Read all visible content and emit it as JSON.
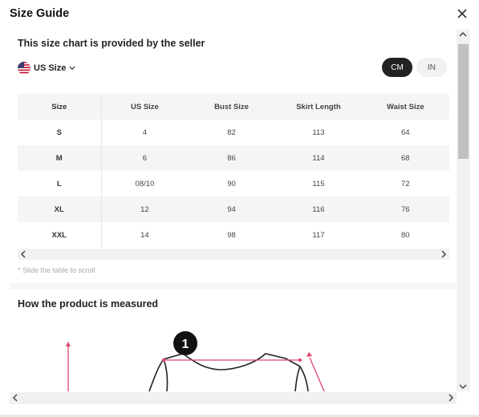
{
  "header": {
    "title": "Size Guide",
    "close_icon": "close-icon"
  },
  "chart": {
    "subtitle": "This size chart is provided by the seller",
    "size_region": "US Size",
    "units": {
      "cm": "CM",
      "in": "IN",
      "selected": "CM"
    },
    "columns": [
      "Size",
      "US Size",
      "Bust Size",
      "Skirt Length",
      "Waist Size"
    ],
    "rows": [
      [
        "S",
        "4",
        "82",
        "113",
        "64"
      ],
      [
        "M",
        "6",
        "86",
        "114",
        "68"
      ],
      [
        "L",
        "08/10",
        "90",
        "115",
        "72"
      ],
      [
        "XL",
        "12",
        "94",
        "116",
        "76"
      ],
      [
        "XXL",
        "14",
        "98",
        "117",
        "80"
      ]
    ],
    "scroll_hint": "* Slide the table to scroll"
  },
  "measure": {
    "title": "How the product is measured",
    "marker": "1"
  },
  "colors": {
    "accent_line": "#e0456e",
    "dark": "#222222"
  }
}
